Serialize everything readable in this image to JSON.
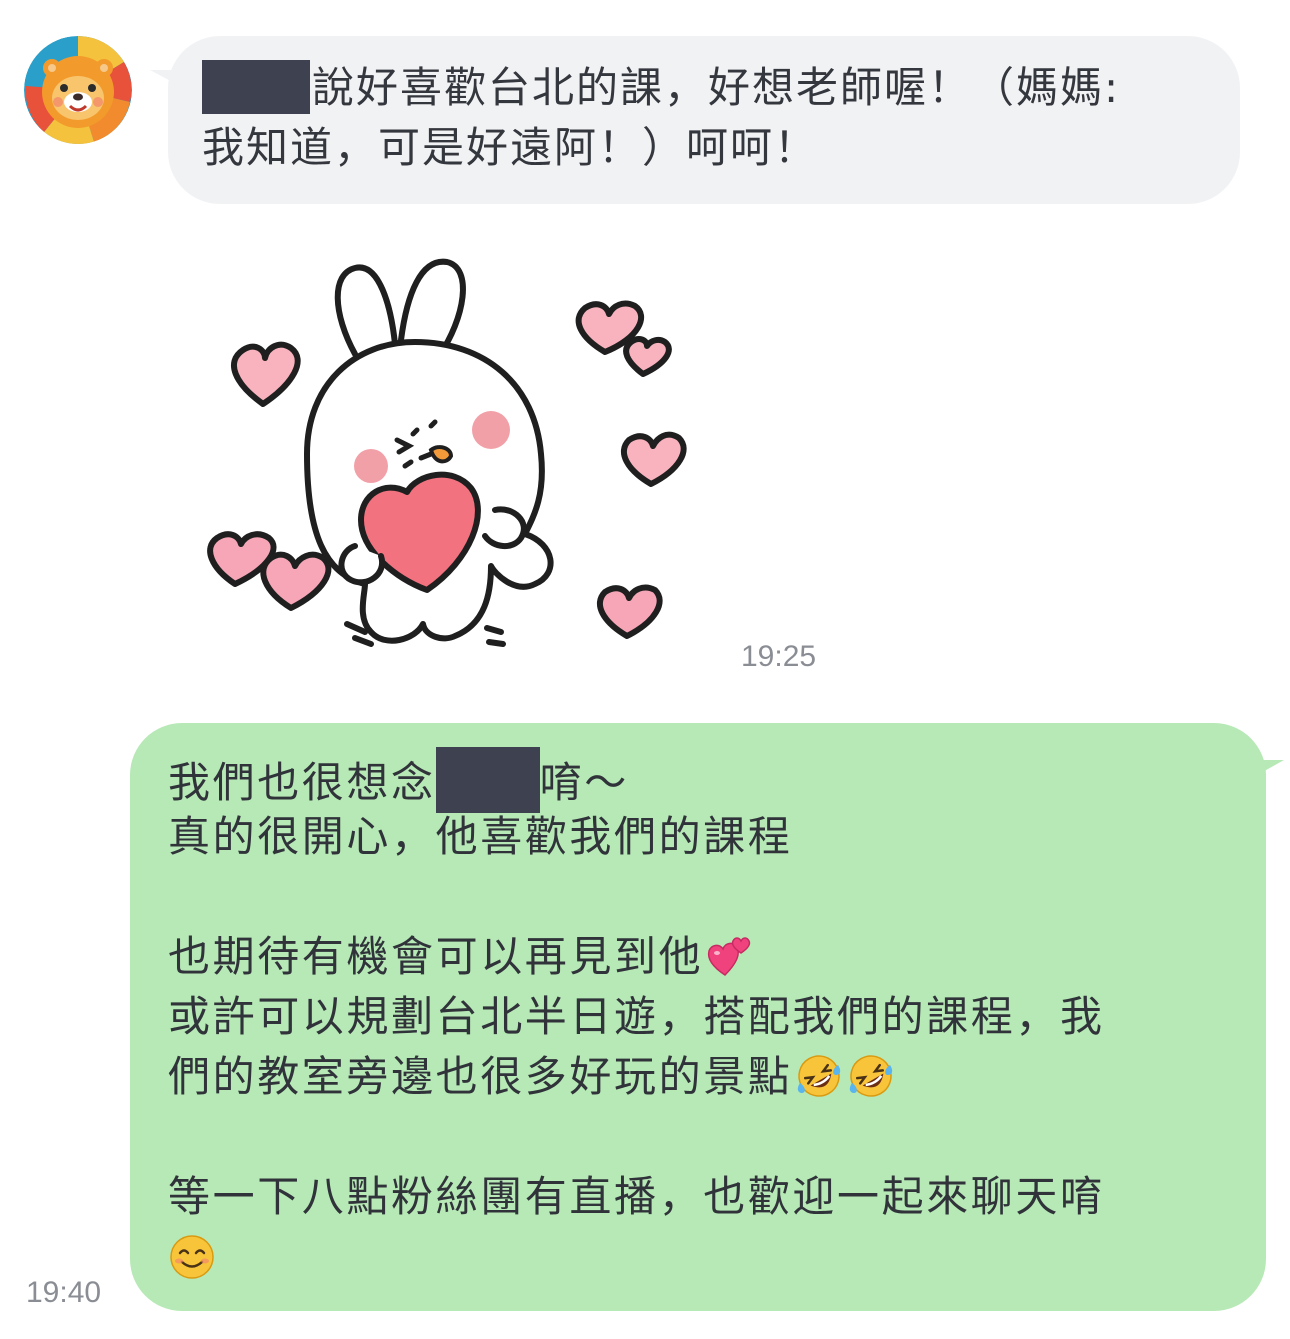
{
  "incoming": {
    "avatar_icon": "lion-avatar-icon",
    "lines": [
      {
        "text": "說好喜歡台北的課，好想老師喔！（媽媽:"
      },
      {
        "text": "我知道，可是好遠阿！）呵呵！"
      }
    ],
    "sticker_icon": "bunny-holding-heart-sticker",
    "time": "19:25"
  },
  "outgoing": {
    "line1_before": "我們也很想念",
    "line1_after": "唷～",
    "line2": "真的很開心，他喜歡我們的課程",
    "line3": "也期待有機會可以再見到他",
    "line3_emoji": "two-hearts-emoji",
    "line4": "或許可以規劃台北半日遊，搭配我們的課程，我",
    "line5": "們的教室旁邊也很多好玩的景點",
    "line5_emoji": "rolling-on-floor-laughing-emoji",
    "line6": "等一下八點粉絲團有直播，也歡迎一起來聊天唷",
    "line7_emoji": "smiling-face-emoji",
    "time": "19:40"
  },
  "colors": {
    "incoming_bubble": "#f1f2f4",
    "outgoing_bubble": "#b7e9b6",
    "redaction": "#3d4150",
    "timestamp": "#8a8d94"
  }
}
